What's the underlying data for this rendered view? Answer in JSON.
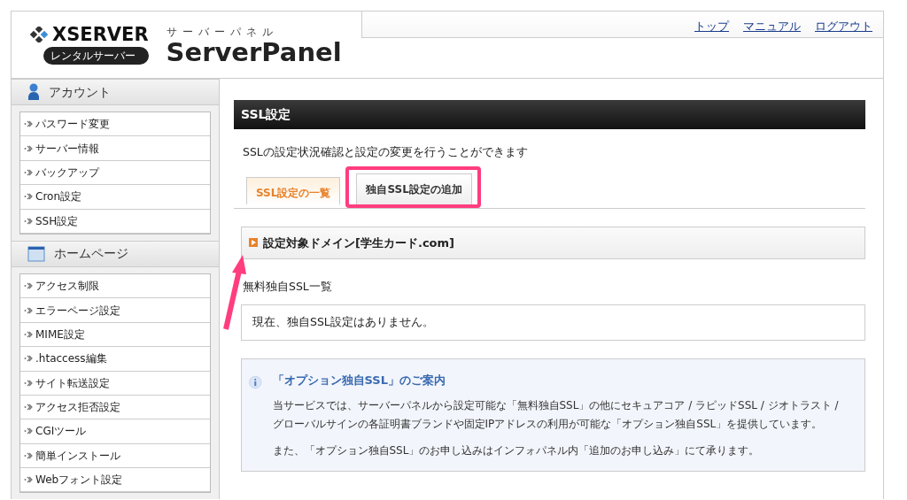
{
  "header": {
    "logo_brand": "XSERVER",
    "logo_badge": "レンタルサーバー",
    "panel_kana": "サーバーパネル",
    "panel_name": "ServerPanel",
    "links": [
      "トップ",
      "マニュアル",
      "ログアウト"
    ]
  },
  "sidebar": [
    {
      "title": "アカウント",
      "kind": "account",
      "items": [
        "パスワード変更",
        "サーバー情報",
        "バックアップ",
        "Cron設定",
        "SSH設定"
      ]
    },
    {
      "title": "ホームページ",
      "kind": "homepage",
      "items": [
        "アクセス制限",
        "エラーページ設定",
        "MIME設定",
        ".htaccess編集",
        "サイト転送設定",
        "アクセス拒否設定",
        "CGIツール",
        "簡単インストール",
        "Webフォント設定"
      ]
    }
  ],
  "main": {
    "title": "SSL設定",
    "description": "SSLの設定状況確認と設定の変更を行うことができます",
    "tabs": [
      {
        "label": "SSL設定の一覧",
        "selected": true,
        "highlighted": false
      },
      {
        "label": "独自SSL設定の追加",
        "selected": false,
        "highlighted": true
      }
    ],
    "domain_heading": "設定対象ドメイン[学生カード.com]",
    "list_label": "無料独自SSL一覧",
    "empty_message": "現在、独自SSL設定はありません。",
    "info": {
      "title": "「オプション独自SSL」のご案内",
      "paragraphs": [
        "当サービスでは、サーバーパネルから設定可能な「無料独自SSL」の他にセキュアコア / ラピッドSSL / ジオトラスト / グローバルサインの各証明書ブランドや固定IPアドレスの利用が可能な「オプション独自SSL」を提供しています。",
        "また、「オプション独自SSL」のお申し込みはインフォパネル内「追加のお申し込み」にて承ります。"
      ]
    }
  }
}
